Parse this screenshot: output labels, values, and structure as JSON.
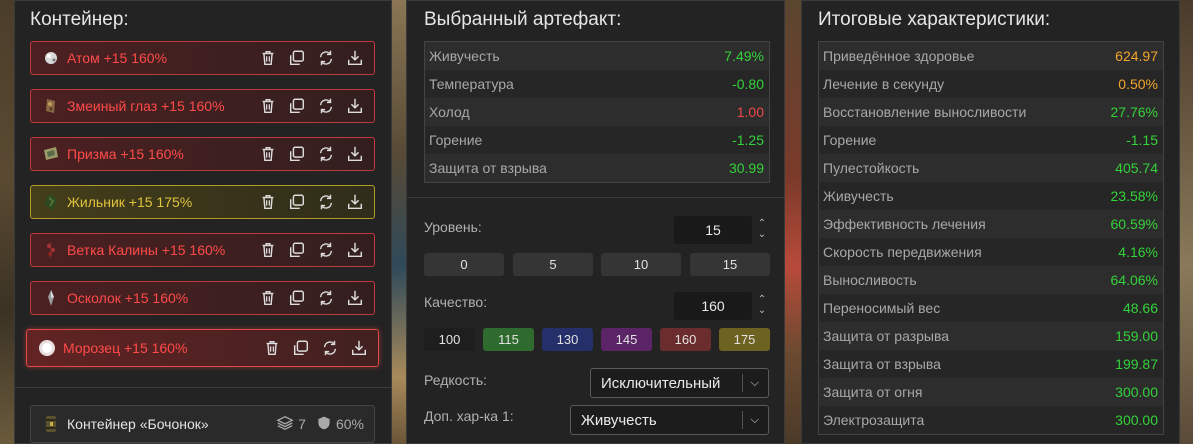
{
  "container_panel": {
    "title": "Контейнер:",
    "items": [
      {
        "label": "Атом +15 160%",
        "variant": "red",
        "icon": "atom-icon"
      },
      {
        "label": "Змеиный глаз +15 160%",
        "variant": "red",
        "icon": "snake-eye-icon"
      },
      {
        "label": "Призма +15 160%",
        "variant": "red",
        "icon": "prism-icon"
      },
      {
        "label": "Жильник +15 175%",
        "variant": "gold",
        "icon": "zhilnik-icon"
      },
      {
        "label": "Ветка Калины +15 160%",
        "variant": "red",
        "icon": "viburnum-branch-icon"
      },
      {
        "label": "Осколок +15 160%",
        "variant": "red",
        "icon": "shard-icon"
      },
      {
        "label": "Морозец +15 160%",
        "variant": "red-selected",
        "icon": "frost-icon"
      }
    ],
    "container": {
      "name": "Контейнер «Бочонок»",
      "slots": "7",
      "protection": "60%"
    }
  },
  "selected_artifact": {
    "title": "Выбранный артефакт:",
    "stats": [
      {
        "name": "Живучесть",
        "value": "7.49%",
        "color": "green"
      },
      {
        "name": "Температура",
        "value": "-0.80",
        "color": "green"
      },
      {
        "name": "Холод",
        "value": "1.00",
        "color": "red"
      },
      {
        "name": "Горение",
        "value": "-1.25",
        "color": "green"
      },
      {
        "name": "Защита от взрыва",
        "value": "30.99",
        "color": "green"
      }
    ],
    "level_label": "Уровень:",
    "level_value": "15",
    "level_presets": [
      "0",
      "5",
      "10",
      "15"
    ],
    "quality_label": "Качество:",
    "quality_value": "160",
    "quality_presets": [
      {
        "label": "100",
        "color": "#1e1e1e"
      },
      {
        "label": "115",
        "color": "#2f6b2f"
      },
      {
        "label": "130",
        "color": "#25306a"
      },
      {
        "label": "145",
        "color": "#5a2466"
      },
      {
        "label": "160",
        "color": "#6a2c2c"
      },
      {
        "label": "175",
        "color": "#6e6220"
      }
    ],
    "rarity_label": "Редкость:",
    "rarity_value": "Исключительный",
    "extra_label": "Доп. хар-ка 1:",
    "extra_value": "Живучесть"
  },
  "totals_panel": {
    "title": "Итоговые характеристики:",
    "stats": [
      {
        "name": "Приведённое здоровье",
        "value": "624.97",
        "color": "orange"
      },
      {
        "name": "Лечение в секунду",
        "value": "0.50%",
        "color": "orange"
      },
      {
        "name": "Восстановление выносливости",
        "value": "27.76%",
        "color": "green"
      },
      {
        "name": "Горение",
        "value": "-1.15",
        "color": "green"
      },
      {
        "name": "Пулестойкость",
        "value": "405.74",
        "color": "green"
      },
      {
        "name": "Живучесть",
        "value": "23.58%",
        "color": "green"
      },
      {
        "name": "Эффективность лечения",
        "value": "60.59%",
        "color": "green"
      },
      {
        "name": "Скорость передвижения",
        "value": "4.16%",
        "color": "green"
      },
      {
        "name": "Выносливость",
        "value": "64.06%",
        "color": "green"
      },
      {
        "name": "Переносимый вес",
        "value": "48.66",
        "color": "green"
      },
      {
        "name": "Защита от разрыва",
        "value": "159.00",
        "color": "green"
      },
      {
        "name": "Защита от взрыва",
        "value": "199.87",
        "color": "green"
      },
      {
        "name": "Защита от огня",
        "value": "300.00",
        "color": "green"
      },
      {
        "name": "Электрозащита",
        "value": "300.00",
        "color": "green"
      }
    ]
  }
}
